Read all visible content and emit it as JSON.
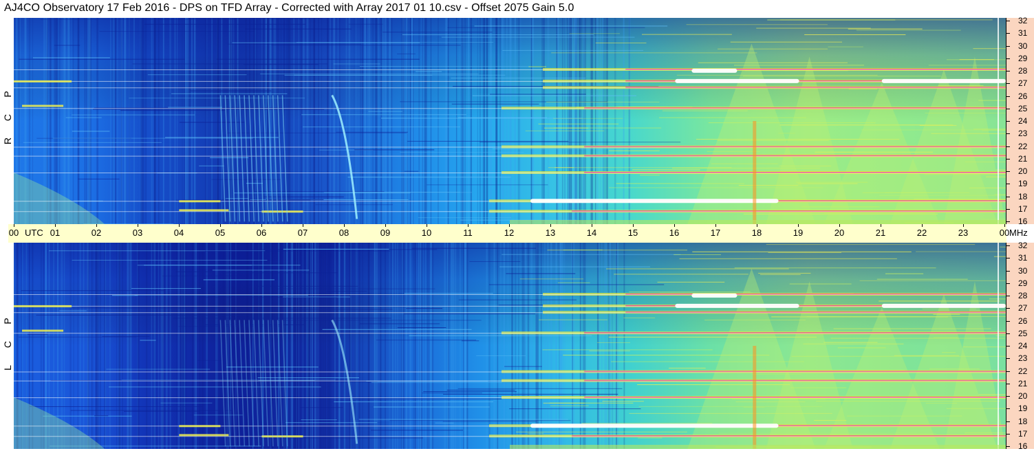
{
  "title": "AJ4CO Observatory  17 Feb 2016  -  DPS on TFD Array  -  Corrected with Array 2017 01 10.csv  -  Offset 2075  Gain 5.0",
  "chart_data": [
    {
      "type": "heatmap",
      "panel": "RCP",
      "polarization_label": [
        "R",
        "C",
        "P"
      ],
      "x_range_utc_hours": [
        0,
        24
      ],
      "y_range_mhz": [
        16,
        32
      ],
      "colormap": [
        "#0d1a9c",
        "#1560e6",
        "#1ea8f0",
        "#3fd7d0",
        "#a4f070",
        "#f0f040",
        "#ff7a20",
        "#e0208c",
        "#ffffff"
      ],
      "background_intensity": "low (dark blue) during 03-08 UTC, high (green/yellow) during 15-24 UTC",
      "storm_features": [
        {
          "type": "fast-drift burst bands",
          "time_utc": [
            5.0,
            6.5
          ]
        },
        {
          "type": "arc burst",
          "time_utc": [
            7.7,
            8.3
          ]
        }
      ],
      "rfi_lines_mhz": [
        17.0,
        17.8,
        20.0,
        21.3,
        22.0,
        25.0,
        26.6,
        27.1,
        28.0
      ]
    },
    {
      "type": "heatmap",
      "panel": "LCP",
      "polarization_label": [
        "L",
        "C",
        "P"
      ],
      "x_range_utc_hours": [
        0,
        24
      ],
      "y_range_mhz": [
        16,
        32
      ],
      "colormap": [
        "#0d1a9c",
        "#1560e6",
        "#1ea8f0",
        "#3fd7d0",
        "#a4f070",
        "#f0f040",
        "#ff7a20",
        "#e0208c",
        "#ffffff"
      ],
      "background_intensity": "low (dark blue) during 03-10 UTC, high (green/yellow) during 15-24 UTC",
      "storm_features": [
        {
          "type": "fast-drift burst bands",
          "time_utc": [
            5.0,
            6.5
          ]
        },
        {
          "type": "arc burst",
          "time_utc": [
            7.7,
            8.3
          ]
        }
      ],
      "rfi_lines_mhz": [
        17.0,
        17.8,
        20.0,
        21.3,
        22.0,
        25.0,
        26.6,
        27.1,
        28.0
      ]
    }
  ],
  "time_axis": {
    "labels": [
      "00",
      "01",
      "02",
      "03",
      "04",
      "05",
      "06",
      "07",
      "08",
      "09",
      "10",
      "11",
      "12",
      "13",
      "14",
      "15",
      "16",
      "17",
      "18",
      "19",
      "20",
      "21",
      "22",
      "23",
      "00"
    ],
    "unit_utc": "UTC",
    "unit_mhz": "MHz"
  },
  "freq_axis": {
    "labels": [
      "32",
      "31",
      "30",
      "29",
      "28",
      "27",
      "26",
      "25",
      "24",
      "23",
      "22",
      "21",
      "20",
      "19",
      "18",
      "17",
      "16"
    ]
  },
  "colors": {
    "time_axis_bg": "#ffffcc",
    "freq_axis_bg": "#fbd6c0"
  }
}
